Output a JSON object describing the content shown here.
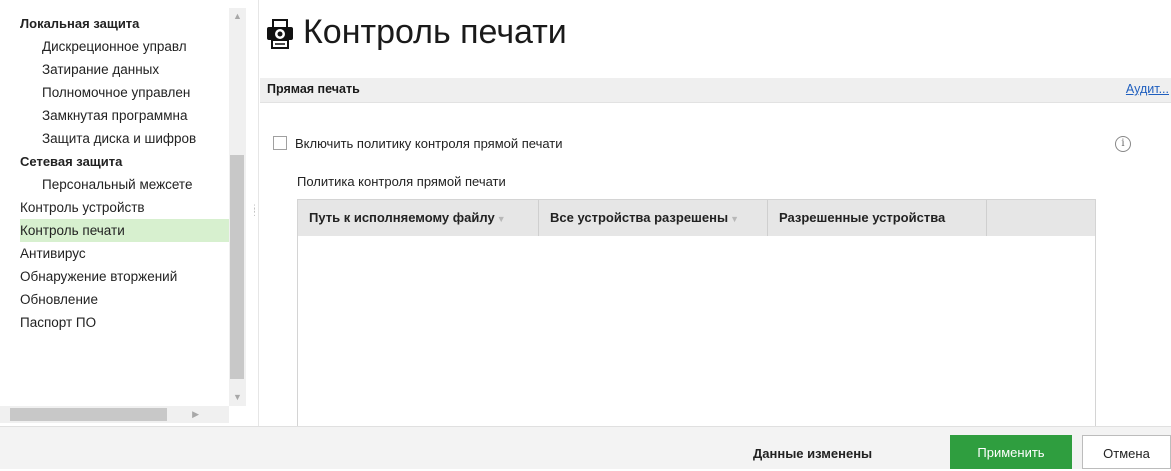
{
  "sidebar": {
    "items": [
      {
        "label": "Локальная защита",
        "kind": "group"
      },
      {
        "label": "Дискреционное управл",
        "kind": "child"
      },
      {
        "label": "Затирание данных",
        "kind": "child"
      },
      {
        "label": "Полномочное управлен",
        "kind": "child"
      },
      {
        "label": "Замкнутая программна",
        "kind": "child"
      },
      {
        "label": "Защита диска и шифров",
        "kind": "child"
      },
      {
        "label": "Сетевая защита",
        "kind": "group"
      },
      {
        "label": "Персональный межсете",
        "kind": "child"
      },
      {
        "label": "Контроль устройств",
        "kind": "top"
      },
      {
        "label": "Контроль печати",
        "kind": "top",
        "selected": true
      },
      {
        "label": "Антивирус",
        "kind": "top"
      },
      {
        "label": "Обнаружение вторжений",
        "kind": "top"
      },
      {
        "label": "Обновление",
        "kind": "top"
      },
      {
        "label": "Паспорт ПО",
        "kind": "top"
      }
    ]
  },
  "main": {
    "title": "Контроль печати",
    "title_icon": "printer-icon",
    "section": {
      "title": "Прямая печать",
      "audit_link": "Аудит..."
    },
    "enable_checkbox": {
      "label": "Включить политику контроля прямой печати",
      "checked": false
    },
    "policy_label": "Политика контроля прямой печати",
    "table": {
      "columns": [
        {
          "label": "Путь к исполняемому файлу",
          "sortable": true
        },
        {
          "label": "Все устройства разрешены",
          "sortable": true
        },
        {
          "label": "Разрешенные устройства",
          "sortable": false
        }
      ],
      "rows": []
    }
  },
  "footer": {
    "status": "Данные изменены",
    "apply_label": "Применить",
    "cancel_label": "Отмена"
  },
  "colors": {
    "accent": "#2f9e3f",
    "selected_bg": "#d7f0cf",
    "link": "#1f5fbf"
  }
}
